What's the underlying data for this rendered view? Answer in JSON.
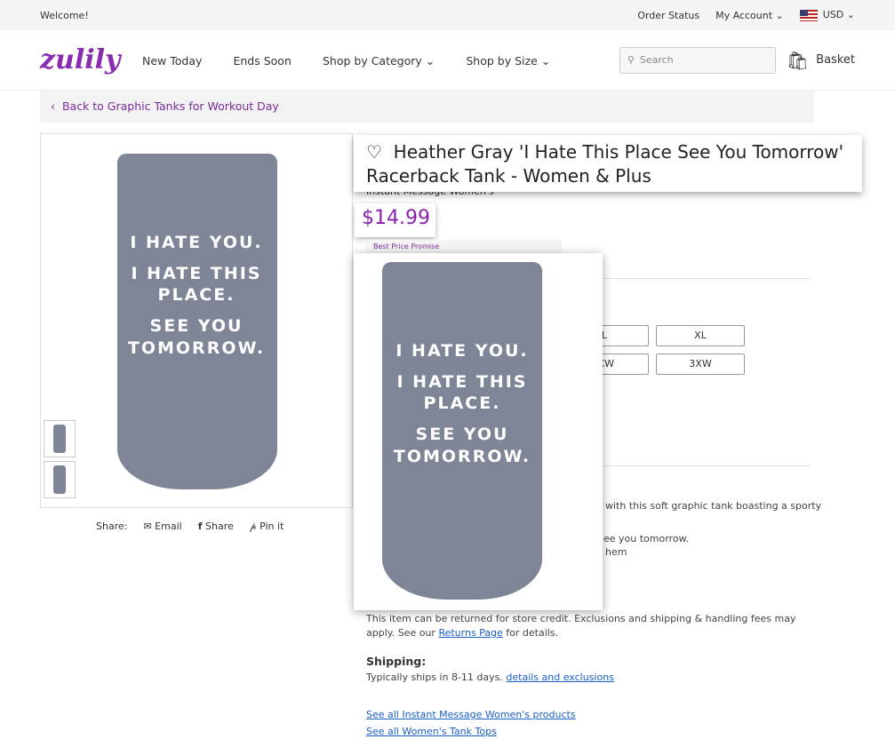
{
  "topbar": {
    "welcome": "Welcome!",
    "order_status": "Order Status",
    "my_account": "My Account",
    "currency": "USD"
  },
  "header": {
    "logo": "zulily",
    "nav": [
      "New Today",
      "Ends Soon",
      "Shop by Category",
      "Shop by Size"
    ],
    "search_placeholder": "Search",
    "basket": "Basket"
  },
  "breadcrumb": "Back to Graphic Tanks for Workout Day",
  "product": {
    "title": "Heather Gray 'I Hate This Place See You Tomorrow' Racerback Tank - Women & Plus",
    "brand": "Instant Message Women's",
    "price": "$14.99",
    "promise": "Best Price Promise",
    "print_lines": [
      "I HATE YOU.",
      "I HATE THIS",
      "PLACE.",
      "SEE YOU",
      "TOMORROW."
    ],
    "sizes": [
      "L",
      "XL",
      "XW",
      "3XW"
    ]
  },
  "share": {
    "label": "Share:",
    "email": "Email",
    "facebook": "Share",
    "pinterest": "Pin it"
  },
  "description": {
    "line1": "with this soft graphic tank boasting a sporty",
    "line2": "ee you tomorrow.",
    "line3": "hem"
  },
  "returns": {
    "text": "This item can be returned for store credit. Exclusions and shipping & handling fees may apply. See our",
    "link": "Returns Page",
    "after": "for details."
  },
  "shipping": {
    "heading": "Shipping:",
    "text": "Typically ships in 8-11 days.",
    "link": "details and exclusions"
  },
  "links": [
    "See all Instant Message Women's products",
    "See all Women's Tank Tops"
  ],
  "colors": {
    "brand": "#8a2bb0",
    "price": "#8a1fb0",
    "link": "#1a5fc7",
    "tank": "#7d8597"
  }
}
